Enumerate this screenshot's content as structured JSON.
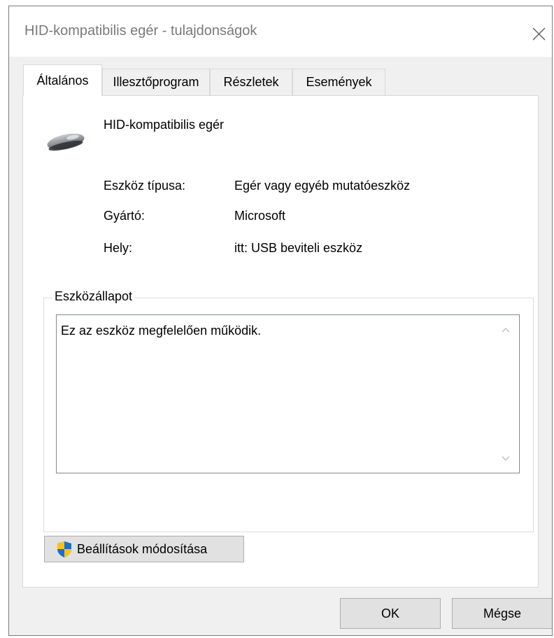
{
  "window": {
    "title": "HID-kompatibilis egér - tulajdonságok"
  },
  "tabs": [
    {
      "label": "Általános",
      "active": true
    },
    {
      "label": "Illesztőprogram",
      "active": false
    },
    {
      "label": "Részletek",
      "active": false
    },
    {
      "label": "Események",
      "active": false
    }
  ],
  "device": {
    "name": "HID-kompatibilis egér",
    "icon": "mouse-icon"
  },
  "properties": [
    {
      "label": "Eszköz típusa:",
      "value": "Egér vagy egyéb mutatóeszköz"
    },
    {
      "label": "Gyártó:",
      "value": "Microsoft"
    },
    {
      "label": "Hely:",
      "value": "itt: USB beviteli eszköz"
    }
  ],
  "status": {
    "group_label": "Eszközállapot",
    "text": "Ez az eszköz megfelelően működik."
  },
  "buttons": {
    "change_settings": "Beállítások módosítása",
    "ok": "OK",
    "cancel": "Mégse"
  },
  "colors": {
    "dialog_bg": "#f0f0f0",
    "panel_bg": "#ffffff",
    "button_bg": "#e1e1e1",
    "shield_blue": "#1c6dd0",
    "shield_yellow": "#f5c518"
  }
}
